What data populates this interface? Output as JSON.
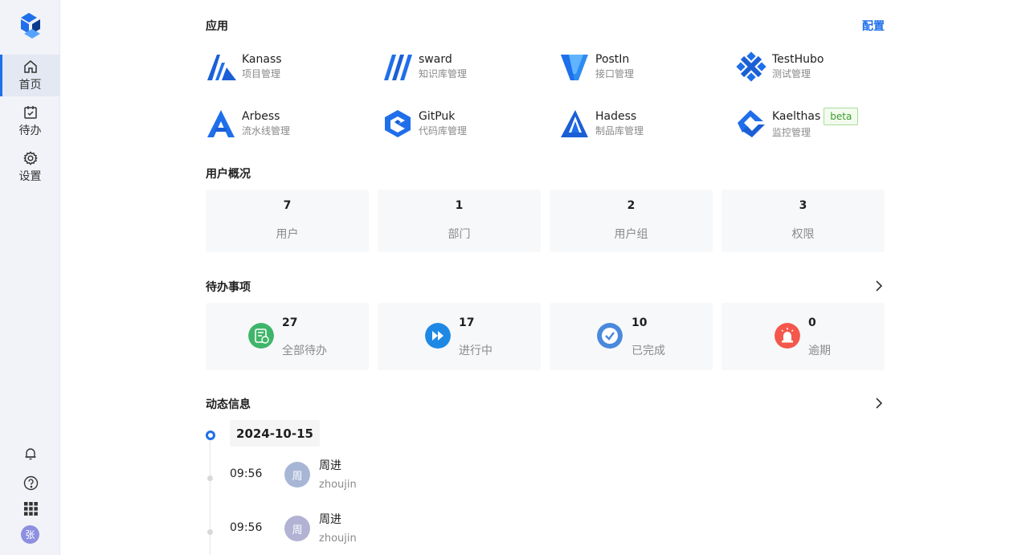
{
  "sidebar": {
    "nav": [
      {
        "label": "首页",
        "icon": "home-icon"
      },
      {
        "label": "待办",
        "icon": "calendar-check-icon"
      },
      {
        "label": "设置",
        "icon": "gear-icon"
      }
    ],
    "bottom_icons": [
      "bell-icon",
      "help-icon",
      "apps-grid-icon"
    ],
    "avatar": "张"
  },
  "apps": {
    "title": "应用",
    "config": "配置",
    "items": [
      {
        "name": "Kanass",
        "desc": "项目管理"
      },
      {
        "name": "sward",
        "desc": "知识库管理"
      },
      {
        "name": "PostIn",
        "desc": "接口管理"
      },
      {
        "name": "TestHubo",
        "desc": "测试管理"
      },
      {
        "name": "Arbess",
        "desc": "流水线管理"
      },
      {
        "name": "GitPuk",
        "desc": "代码库管理"
      },
      {
        "name": "Hadess",
        "desc": "制品库管理"
      },
      {
        "name": "Kaelthas",
        "desc": "监控管理",
        "badge": "beta"
      }
    ]
  },
  "users": {
    "title": "用户概况",
    "stats": [
      {
        "value": "7",
        "label": "用户"
      },
      {
        "value": "1",
        "label": "部门"
      },
      {
        "value": "2",
        "label": "用户组"
      },
      {
        "value": "3",
        "label": "权限"
      }
    ]
  },
  "todo": {
    "title": "待办事项",
    "stats": [
      {
        "value": "27",
        "label": "全部待办",
        "color": "#3fb56a"
      },
      {
        "value": "17",
        "label": "进行中",
        "color": "#1e88e5"
      },
      {
        "value": "10",
        "label": "已完成",
        "color": "#4a89dc"
      },
      {
        "value": "0",
        "label": "逾期",
        "color": "#f4574b"
      }
    ]
  },
  "activity": {
    "title": "动态信息",
    "date": "2024-10-15",
    "entries": [
      {
        "time": "09:56",
        "avatar": "周",
        "name": "周进",
        "user": "zhoujin"
      },
      {
        "time": "09:56",
        "avatar": "周",
        "name": "周进",
        "user": "zhoujin"
      }
    ]
  },
  "colors": {
    "accent": "#1f6feb",
    "brand": "#1a5fd6"
  }
}
